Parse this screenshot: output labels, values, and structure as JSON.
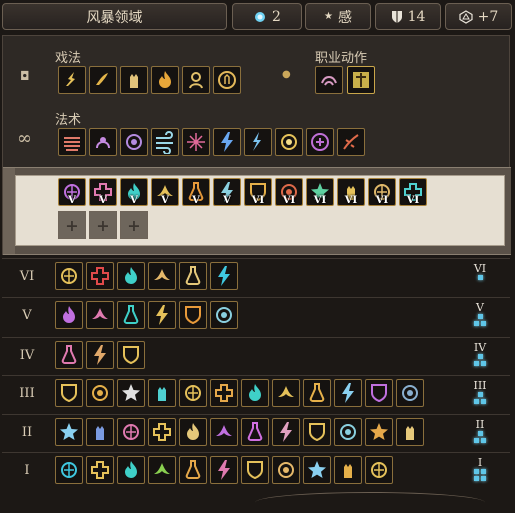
{
  "topbar": {
    "title": "风暴领域",
    "spell_slots": "2",
    "ability": "感",
    "ac_or_hp": "14",
    "bonus": "+7"
  },
  "sections": {
    "cantrips_label": "戏法",
    "class_actions_label": "职业动作",
    "spells_label": "法术",
    "infinite_symbol": "∞"
  },
  "prepared_levels": [
    "V",
    "V",
    "V",
    "V",
    "V",
    "V",
    "VI",
    "VI",
    "VI",
    "VI",
    "VI",
    "VI"
  ],
  "rows": [
    {
      "label": "VI",
      "right": "VI",
      "pips": 1
    },
    {
      "label": "V",
      "right": "V",
      "pips": 3
    },
    {
      "label": "IV",
      "right": "IV",
      "pips": 3
    },
    {
      "label": "III",
      "right": "III",
      "pips": 3
    },
    {
      "label": "II",
      "right": "II",
      "pips": 3
    },
    {
      "label": "I",
      "right": "I",
      "pips": 4
    }
  ],
  "colors": {
    "slot_border": "#8a6f3c",
    "pip": "#5fc6e8"
  }
}
